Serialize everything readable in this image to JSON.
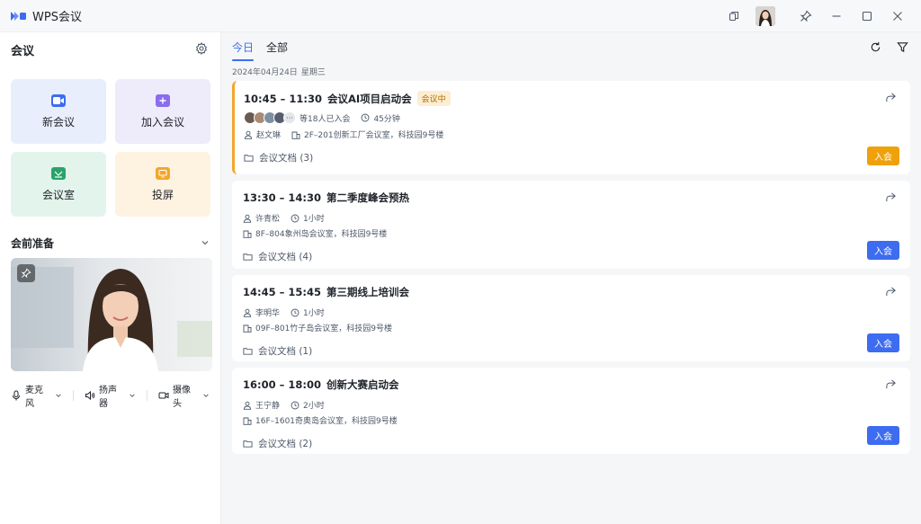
{
  "app": {
    "title": "WPS会议"
  },
  "sidebar": {
    "title": "会议",
    "tiles": [
      {
        "label": "新会议"
      },
      {
        "label": "加入会议"
      },
      {
        "label": "会议室"
      },
      {
        "label": "投屏"
      }
    ],
    "prep_title": "会前准备",
    "devices": [
      {
        "label": "麦克风"
      },
      {
        "label": "扬声器"
      },
      {
        "label": "摄像头"
      }
    ]
  },
  "main": {
    "tabs": [
      {
        "label": "今日",
        "active": true
      },
      {
        "label": "全部",
        "active": false
      }
    ],
    "date": "2024年04月24日",
    "weekday": "星期三",
    "meetings": [
      {
        "time": "10:45 – 11:30",
        "name": "会议AI项目启动会",
        "status": "会议中",
        "joined": "等18人已入会",
        "duration": "45分钟",
        "host": "赵文琳",
        "location": "2F–201创新工厂会议室，科技园9号楼",
        "docs": "会议文档 (3)",
        "join": "入会"
      },
      {
        "time": "13:30 – 14:30",
        "name": "第二季度峰会预热",
        "host": "许青松",
        "duration": "1小时",
        "location": "8F–804象州岛会议室，科技园9号楼",
        "docs": "会议文档 (4)",
        "join": "入会"
      },
      {
        "time": "14:45 – 15:45",
        "name": "第三期线上培训会",
        "host": "李明华",
        "duration": "1小时",
        "location": "09F–801竹子岛会议室，科技园9号楼",
        "docs": "会议文档 (1)",
        "join": "入会"
      },
      {
        "time": "16:00 – 18:00",
        "name": "创新大赛启动会",
        "host": "王宁静",
        "duration": "2小时",
        "location": "16F–1601奇奥岛会议室，科技园9号楼",
        "docs": "会议文档 (2)",
        "join": "入会"
      }
    ]
  },
  "colors": {
    "accent": "#3d6cf0",
    "ongoing": "#f2a72c",
    "join_ongoing": "#eea10a"
  }
}
